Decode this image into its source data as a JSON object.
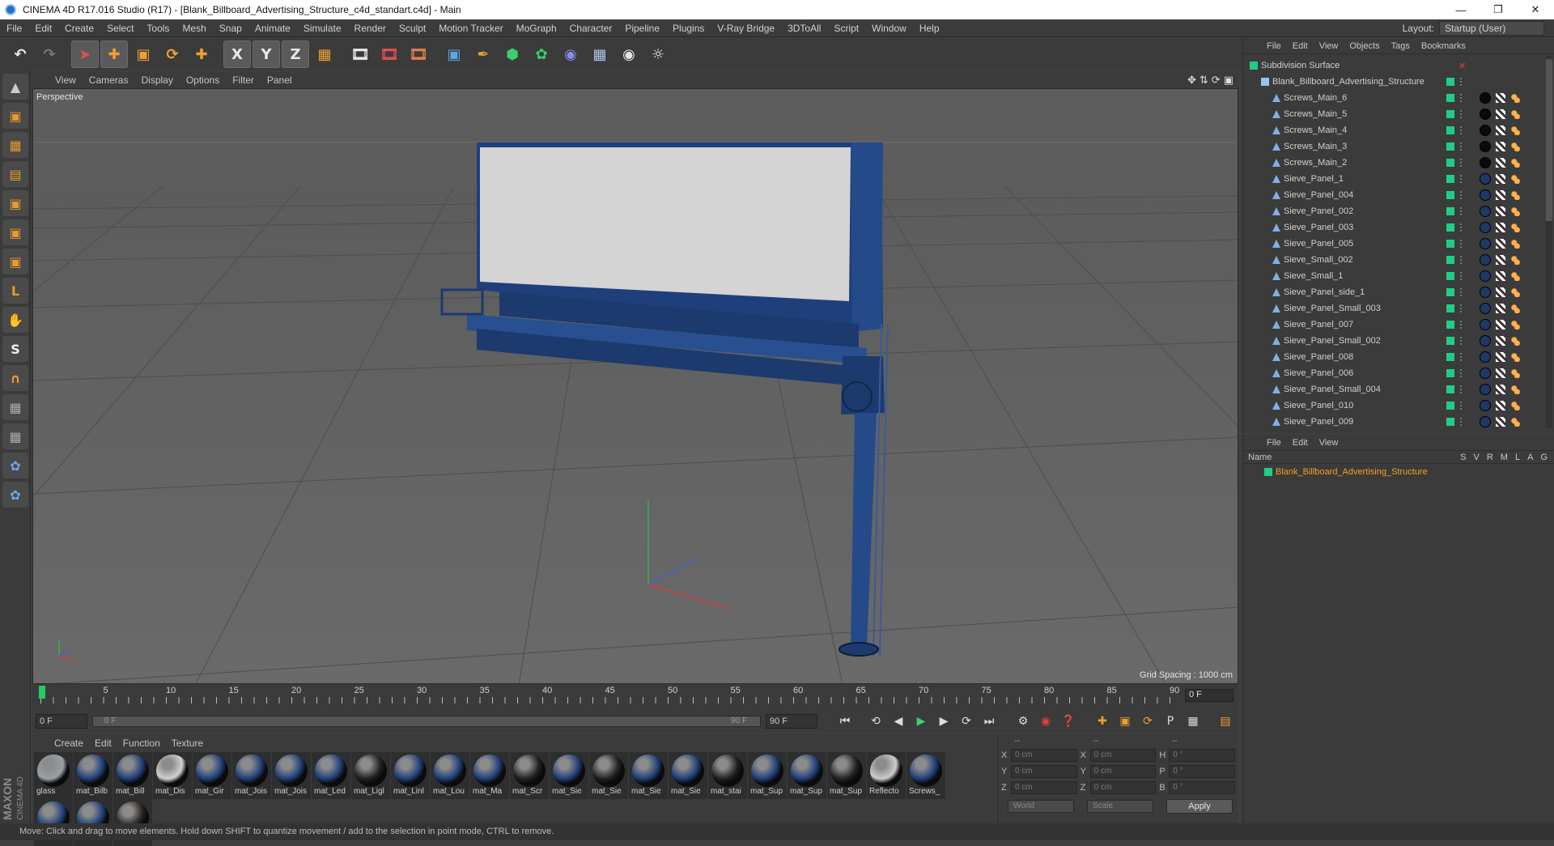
{
  "window": {
    "title": "CINEMA 4D R17.016 Studio (R17) - [Blank_Billboard_Advertising_Structure_c4d_standart.c4d] - Main"
  },
  "menubar": {
    "items": [
      "File",
      "Edit",
      "Create",
      "Select",
      "Tools",
      "Mesh",
      "Snap",
      "Animate",
      "Simulate",
      "Render",
      "Sculpt",
      "Motion Tracker",
      "MoGraph",
      "Character",
      "Pipeline",
      "Plugins",
      "V-Ray Bridge",
      "3DToAll",
      "Script",
      "Window",
      "Help"
    ],
    "layout_label": "Layout:",
    "layout_value": "Startup (User)"
  },
  "toolbar": {
    "icons": [
      "undo-icon",
      "redo-icon",
      "select-icon",
      "move-icon",
      "scale-icon",
      "rotate-icon",
      "add-icon",
      "x-axis-icon",
      "y-axis-icon",
      "z-axis-icon",
      "coordinate-icon",
      "render-view-icon",
      "render-picture-queue-icon",
      "render-settings-icon",
      "cube-icon",
      "pen-icon",
      "subdivision-icon",
      "cloner-icon",
      "deformer-icon",
      "floor-icon",
      "camera-icon",
      "light-icon"
    ],
    "axis_labels": [
      "X",
      "Y",
      "Z"
    ]
  },
  "viewport": {
    "menu": [
      "View",
      "Cameras",
      "Display",
      "Options",
      "Filter",
      "Panel"
    ],
    "label": "Perspective",
    "grid_spacing": "Grid Spacing : 1000 cm"
  },
  "timeline": {
    "ticks": [
      "0",
      "5",
      "10",
      "15",
      "20",
      "25",
      "30",
      "35",
      "40",
      "45",
      "50",
      "55",
      "60",
      "65",
      "70",
      "75",
      "80",
      "85",
      "90"
    ],
    "current_frame": "0 F",
    "start_field": "0 F",
    "slider_left": "0 F",
    "slider_right": "90 F",
    "end_field": "90 F"
  },
  "materials": {
    "menu": [
      "Create",
      "Edit",
      "Function",
      "Texture"
    ],
    "items": [
      {
        "name": "glass",
        "color": "#9aa0a6"
      },
      {
        "name": "mat_Bilb",
        "color": "#1f3f7a"
      },
      {
        "name": "mat_Bill",
        "color": "#1f3f7a"
      },
      {
        "name": "mat_Dis",
        "color": "#d0d0d0"
      },
      {
        "name": "mat_Gir",
        "color": "#1f3f7a"
      },
      {
        "name": "mat_Jois",
        "color": "#1f3f7a"
      },
      {
        "name": "mat_Jois",
        "color": "#1f3f7a"
      },
      {
        "name": "mat_Led",
        "color": "#1f3f7a"
      },
      {
        "name": "mat_Ligl",
        "color": "#222222"
      },
      {
        "name": "mat_Linl",
        "color": "#1f3f7a"
      },
      {
        "name": "mat_Lou",
        "color": "#1f3f7a"
      },
      {
        "name": "mat_Ma",
        "color": "#1f3f7a"
      },
      {
        "name": "mat_Scr",
        "color": "#222222"
      },
      {
        "name": "mat_Sie",
        "color": "#1f3f7a"
      },
      {
        "name": "mat_Sie",
        "color": "#222222"
      },
      {
        "name": "mat_Sie",
        "color": "#1f3f7a"
      },
      {
        "name": "mat_Sie",
        "color": "#1f3f7a"
      },
      {
        "name": "mat_stai",
        "color": "#222222"
      },
      {
        "name": "mat_Sup",
        "color": "#1f3f7a"
      },
      {
        "name": "mat_Sup",
        "color": "#1f3f7a"
      },
      {
        "name": "mat_Sup",
        "color": "#222222"
      },
      {
        "name": "Reflecto",
        "color": "#cccccc"
      },
      {
        "name": "Screws_",
        "color": "#1f3f7a"
      },
      {
        "name": "",
        "color": "#1f3f7a"
      },
      {
        "name": "",
        "color": "#1f3f7a"
      },
      {
        "name": "",
        "color": "#2a2522"
      }
    ]
  },
  "coordinates": {
    "header": [
      "--",
      "--",
      "--"
    ],
    "rows": [
      {
        "a": "X",
        "av": "0 cm",
        "b": "X",
        "bv": "0 cm",
        "c": "H",
        "cv": "0 °"
      },
      {
        "a": "Y",
        "av": "0 cm",
        "b": "Y",
        "bv": "0 cm",
        "c": "P",
        "cv": "0 °"
      },
      {
        "a": "Z",
        "av": "0 cm",
        "b": "Z",
        "bv": "0 cm",
        "c": "B",
        "cv": "0 °"
      }
    ],
    "space": "World",
    "mode": "Scale",
    "apply": "Apply"
  },
  "objects": {
    "menu": [
      "File",
      "Edit",
      "View",
      "Objects",
      "Tags",
      "Bookmarks"
    ],
    "items": [
      {
        "name": "Subdivision Surface",
        "indent": 0,
        "icon": "subdivision-icon"
      },
      {
        "name": "Blank_Billboard_Advertising_Structure",
        "indent": 1,
        "icon": "null-icon"
      },
      {
        "name": "Screws_Main_6",
        "indent": 2,
        "icon": "polygon-icon",
        "tag": "black"
      },
      {
        "name": "Screws_Main_5",
        "indent": 2,
        "icon": "polygon-icon",
        "tag": "black"
      },
      {
        "name": "Screws_Main_4",
        "indent": 2,
        "icon": "polygon-icon",
        "tag": "black"
      },
      {
        "name": "Screws_Main_3",
        "indent": 2,
        "icon": "polygon-icon",
        "tag": "black"
      },
      {
        "name": "Screws_Main_2",
        "indent": 2,
        "icon": "polygon-icon",
        "tag": "black"
      },
      {
        "name": "Sieve_Panel_1",
        "indent": 2,
        "icon": "polygon-icon",
        "tag": "blue"
      },
      {
        "name": "Sieve_Panel_004",
        "indent": 2,
        "icon": "polygon-icon",
        "tag": "blue"
      },
      {
        "name": "Sieve_Panel_002",
        "indent": 2,
        "icon": "polygon-icon",
        "tag": "blue"
      },
      {
        "name": "Sieve_Panel_003",
        "indent": 2,
        "icon": "polygon-icon",
        "tag": "blue"
      },
      {
        "name": "Sieve_Panel_005",
        "indent": 2,
        "icon": "polygon-icon",
        "tag": "blue"
      },
      {
        "name": "Sieve_Small_002",
        "indent": 2,
        "icon": "polygon-icon",
        "tag": "blue"
      },
      {
        "name": "Sieve_Small_1",
        "indent": 2,
        "icon": "polygon-icon",
        "tag": "blue"
      },
      {
        "name": "Sieve_Panel_side_1",
        "indent": 2,
        "icon": "polygon-icon",
        "tag": "blue"
      },
      {
        "name": "Sieve_Panel_Small_003",
        "indent": 2,
        "icon": "polygon-icon",
        "tag": "blue"
      },
      {
        "name": "Sieve_Panel_007",
        "indent": 2,
        "icon": "polygon-icon",
        "tag": "blue"
      },
      {
        "name": "Sieve_Panel_Small_002",
        "indent": 2,
        "icon": "polygon-icon",
        "tag": "blue"
      },
      {
        "name": "Sieve_Panel_008",
        "indent": 2,
        "icon": "polygon-icon",
        "tag": "blue"
      },
      {
        "name": "Sieve_Panel_006",
        "indent": 2,
        "icon": "polygon-icon",
        "tag": "blue"
      },
      {
        "name": "Sieve_Panel_Small_004",
        "indent": 2,
        "icon": "polygon-icon",
        "tag": "blue"
      },
      {
        "name": "Sieve_Panel_010",
        "indent": 2,
        "icon": "polygon-icon",
        "tag": "blue"
      },
      {
        "name": "Sieve_Panel_009",
        "indent": 2,
        "icon": "polygon-icon",
        "tag": "blue"
      }
    ]
  },
  "attributes": {
    "menu": [
      "File",
      "Edit",
      "View"
    ],
    "name_header": "Name",
    "columns": [
      "S",
      "V",
      "R",
      "M",
      "L",
      "A",
      "G"
    ],
    "row": "Blank_Billboard_Advertising_Structure"
  },
  "status": {
    "text": "Move: Click and drag to move elements. Hold down SHIFT to quantize movement / add to the selection in point mode, CTRL to remove."
  },
  "brand": {
    "maxon": "MAXON",
    "c4d": "CINEMA 4D"
  }
}
